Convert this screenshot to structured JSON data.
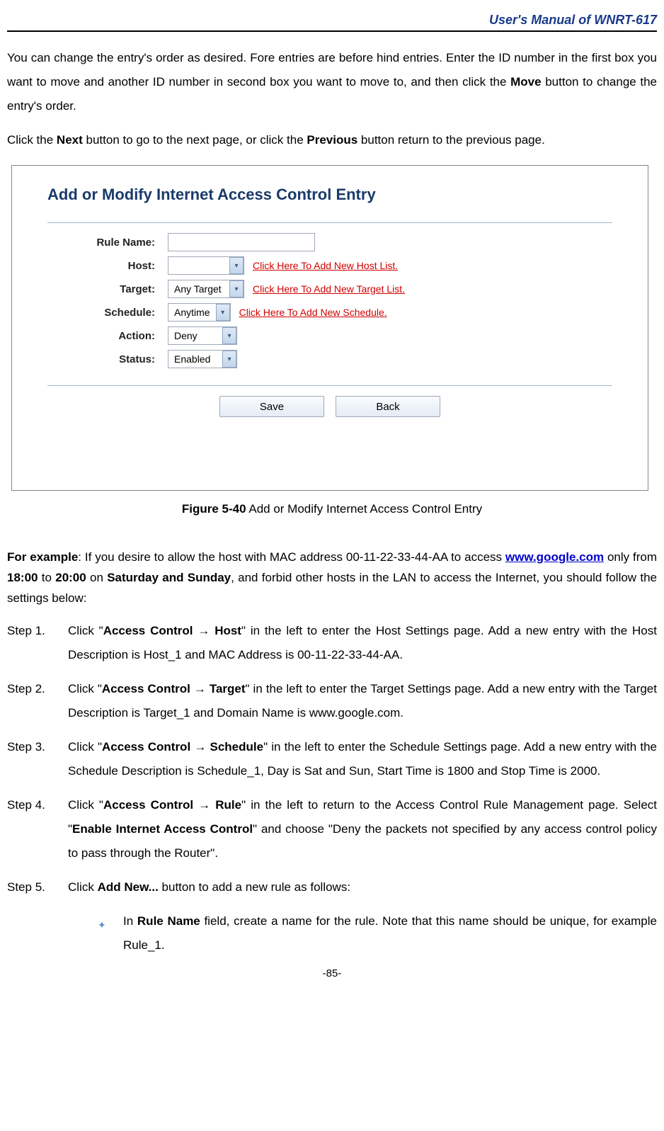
{
  "header": {
    "title": "User's Manual of WNRT-617"
  },
  "intro": {
    "p1_a": "You can change the entry's order as desired. Fore entries are before hind entries. Enter the ID number in the first box you want to move and another ID number in second box you want to move to, and then click the ",
    "p1_bold1": "Move",
    "p1_b": " button to change the entry's order.",
    "p2_a": "Click the ",
    "p2_bold1": "Next",
    "p2_b": " button to go to the next page, or click the ",
    "p2_bold2": "Previous",
    "p2_c": " button return to the previous page."
  },
  "figure": {
    "title": "Add or Modify Internet Access Control Entry",
    "labels": {
      "rule_name": "Rule Name:",
      "host": "Host:",
      "target": "Target:",
      "schedule": "Schedule:",
      "action": "Action:",
      "status": "Status:"
    },
    "values": {
      "rule_name": "",
      "host": "",
      "target": "Any Target",
      "schedule": "Anytime",
      "action": "Deny",
      "status": "Enabled"
    },
    "links": {
      "host": "Click Here To Add New Host List.",
      "target": "Click Here To Add New Target List.",
      "schedule": "Click Here To Add New Schedule."
    },
    "buttons": {
      "save": "Save",
      "back": "Back"
    }
  },
  "caption": {
    "bold": "Figure 5-40",
    "text": "    Add or Modify Internet Access Control Entry"
  },
  "example": {
    "lead_bold": "For example",
    "lead_a": ": If you desire to allow the host with MAC address 00-11-22-33-44-AA to access ",
    "link": "www.google.com",
    "lead_b": " only from ",
    "bold_1800": "18:00",
    "lead_c": " to ",
    "bold_2000": "20:00",
    "lead_d": " on ",
    "bold_satsun": "Saturday and Sunday",
    "lead_e": ", and forbid other hosts in the LAN to access the Internet, you should follow the settings below:"
  },
  "steps": {
    "s1": {
      "num": "Step 1.",
      "a": "Click \"",
      "bold1": "Access Control → Host",
      "b": "\" in the left to enter the Host Settings page. Add a new entry with the Host Description is Host_1 and MAC Address is 00-11-22-33-44-AA."
    },
    "s2": {
      "num": "Step 2.",
      "a": "Click \"",
      "bold1": "Access Control → Target",
      "b": "\" in the left to enter the Target Settings page. Add a new entry with the Target Description is Target_1 and Domain Name is www.google.com."
    },
    "s3": {
      "num": "Step 3.",
      "a": "Click \"",
      "bold1": "Access Control → Schedule",
      "b": "\" in the left to enter the Schedule Settings page. Add a new entry with the Schedule Description is Schedule_1, Day is Sat and Sun, Start Time is 1800 and Stop Time is 2000."
    },
    "s4": {
      "num": "Step 4.",
      "a": "Click \"",
      "bold1": "Access Control → Rule",
      "b": "\" in the left to return to the Access Control Rule Management page. Select \"",
      "bold2": "Enable Internet Access Control",
      "c": "\" and choose \"Deny the packets not specified by any access control policy to pass through the Router\"."
    },
    "s5": {
      "num": "Step 5.",
      "a": "Click ",
      "bold1": "Add New...",
      "b": " button to add a new rule as follows:"
    }
  },
  "bullet1": {
    "a": "In ",
    "bold1": "Rule Name",
    "b": " field, create a name for the rule. Note that this name should be unique, for example Rule_1."
  },
  "page_num": "-85-"
}
